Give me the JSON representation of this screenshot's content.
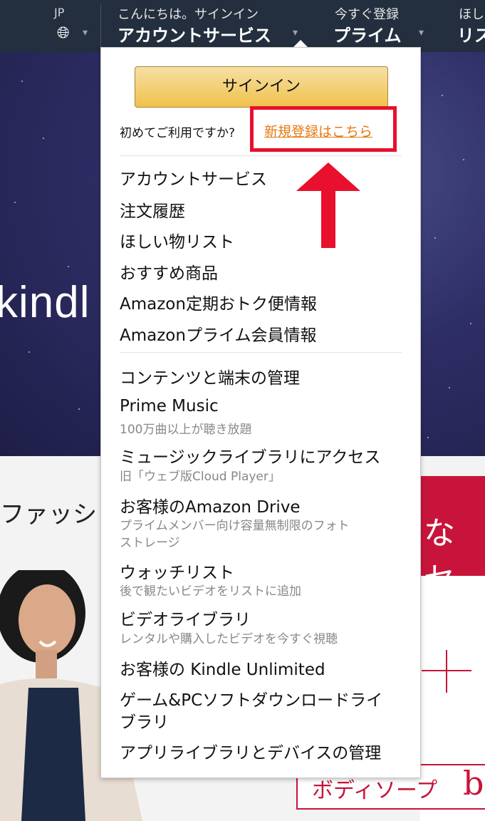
{
  "nav": {
    "country_code": "JP",
    "greeting": "こんにちは。サインイン",
    "account_label": "アカウントサービス",
    "signup_small": "今すぐ登録",
    "prime_label": "プライム",
    "wishlist_small": "ほし",
    "wishlist_label": "リス"
  },
  "hero": {
    "brand": "kindl"
  },
  "dropdown": {
    "signin_button": "サインイン",
    "first_time_text": "初めてご利用ですか?",
    "register_link": "新規登録はこちら",
    "group1": [
      "アカウントサービス",
      "注文履歴",
      "ほしい物リスト",
      "おすすめ商品",
      "Amazon定期おトク便情報",
      "Amazonプライム会員情報"
    ],
    "group2": [
      {
        "label": "コンテンツと端末の管理"
      },
      {
        "label": "Prime Music",
        "sub": "100万曲以上が聴き放題"
      },
      {
        "label": "ミュージックライブラリにアクセス",
        "sub": "旧「ウェブ版Cloud Player」"
      },
      {
        "label": "お客様のAmazon Drive",
        "sub": "プライムメンバー向け容量無制限のフォト",
        "sub2": "ストレージ"
      },
      {
        "label": "ウォッチリスト",
        "sub": "後で観たいビデオをリストに追加"
      },
      {
        "label": "ビデオライブラリ",
        "sub": "レンタルや購入したビデオを今すぐ視聴"
      },
      {
        "label": "お客様の Kindle Unlimited"
      },
      {
        "label": "ゲーム&PCソフトダウンロードライ",
        "label2": "ブラリ"
      },
      {
        "label": "アプリライブラリとデバイスの管理"
      }
    ]
  },
  "background": {
    "fashion_text": "ファッシ",
    "promo_text": "なセ",
    "body_soap_text": "ボディソープ",
    "body_soap_big": "b"
  },
  "colors": {
    "nav_bg": "#232f3e",
    "signin_button": "#f0c14b",
    "link_orange": "#e47911",
    "highlight_red": "#e8102d",
    "promo_red": "#c8143a"
  }
}
